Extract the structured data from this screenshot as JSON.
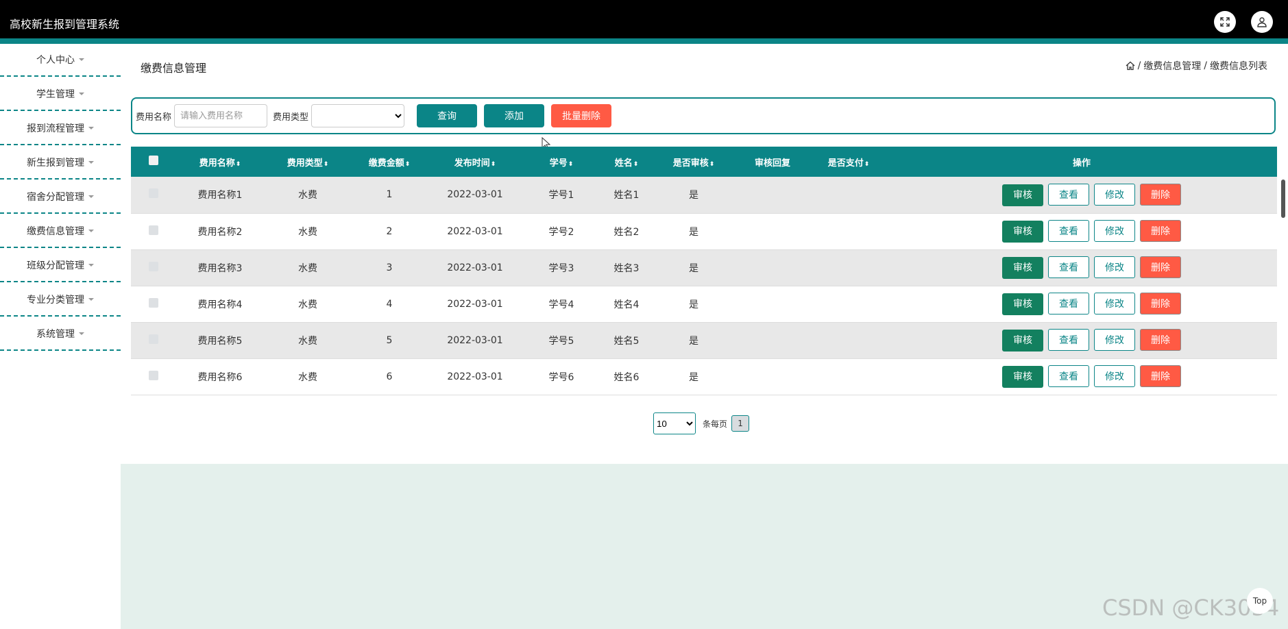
{
  "header": {
    "title": "高校新生报到管理系统"
  },
  "sidebar": {
    "items": [
      {
        "label": "个人中心"
      },
      {
        "label": "学生管理"
      },
      {
        "label": "报到流程管理"
      },
      {
        "label": "新生报到管理"
      },
      {
        "label": "宿舍分配管理"
      },
      {
        "label": "缴费信息管理"
      },
      {
        "label": "班级分配管理"
      },
      {
        "label": "专业分类管理"
      },
      {
        "label": "系统管理"
      }
    ]
  },
  "page": {
    "title": "缴费信息管理",
    "breadcrumb": [
      "缴费信息管理",
      "缴费信息列表"
    ]
  },
  "search": {
    "name_label": "费用名称",
    "name_placeholder": "请输入费用名称",
    "type_label": "费用类型",
    "query_label": "查询",
    "add_label": "添加",
    "batch_delete_label": "批量删除"
  },
  "table": {
    "columns": [
      "费用名称",
      "费用类型",
      "缴费金额",
      "发布时间",
      "学号",
      "姓名",
      "是否审核",
      "审核回复",
      "是否支付",
      "操作"
    ],
    "rows": [
      {
        "name": "费用名称1",
        "type": "水费",
        "amount": "1",
        "time": "2022-03-01",
        "sid": "学号1",
        "sname": "姓名1",
        "audited": "是",
        "reply": "",
        "paid": ""
      },
      {
        "name": "费用名称2",
        "type": "水费",
        "amount": "2",
        "time": "2022-03-01",
        "sid": "学号2",
        "sname": "姓名2",
        "audited": "是",
        "reply": "",
        "paid": ""
      },
      {
        "name": "费用名称3",
        "type": "水费",
        "amount": "3",
        "time": "2022-03-01",
        "sid": "学号3",
        "sname": "姓名3",
        "audited": "是",
        "reply": "",
        "paid": ""
      },
      {
        "name": "费用名称4",
        "type": "水费",
        "amount": "4",
        "time": "2022-03-01",
        "sid": "学号4",
        "sname": "姓名4",
        "audited": "是",
        "reply": "",
        "paid": ""
      },
      {
        "name": "费用名称5",
        "type": "水费",
        "amount": "5",
        "time": "2022-03-01",
        "sid": "学号5",
        "sname": "姓名5",
        "audited": "是",
        "reply": "",
        "paid": ""
      },
      {
        "name": "费用名称6",
        "type": "水费",
        "amount": "6",
        "time": "2022-03-01",
        "sid": "学号6",
        "sname": "姓名6",
        "audited": "是",
        "reply": "",
        "paid": ""
      }
    ],
    "actions": {
      "audit": "审核",
      "view": "查看",
      "edit": "修改",
      "delete": "删除"
    }
  },
  "pagination": {
    "page_size": "10",
    "per_page_label": "条每页",
    "current_page": "1"
  },
  "top_button": "Top",
  "watermark": "CSDN @CK3034",
  "colors": {
    "accent": "#0b8587",
    "danger": "#ff5a44",
    "audit": "#13805f"
  }
}
